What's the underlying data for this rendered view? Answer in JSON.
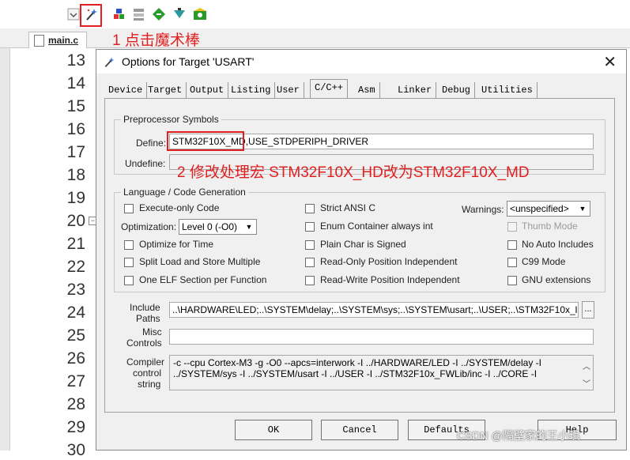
{
  "toolbar": {
    "icons": [
      "dropdown-icon",
      "magic-wand-icon",
      "build-icon",
      "batch-icon",
      "download-icon",
      "debug-icon",
      "manage-icon"
    ]
  },
  "annotations": {
    "step1": "1 点击魔术棒",
    "step2": "2 修改处理宏 STM32F10X_HD改为STM32F10X_MD"
  },
  "editor": {
    "file_tab": "main.c",
    "line_numbers": [
      "13",
      "14",
      "15",
      "16",
      "17",
      "18",
      "19",
      "20",
      "21",
      "22",
      "23",
      "24",
      "25",
      "26",
      "27",
      "28",
      "29",
      "30"
    ]
  },
  "dialog": {
    "title": "Options for Target 'USART'",
    "close": "✕",
    "tabs": [
      "Device",
      "Target",
      "Output",
      "Listing",
      "User",
      "C/C++",
      "Asm",
      "Linker",
      "Debug",
      "Utilities"
    ],
    "active_tab": "C/C++",
    "preprocessor": {
      "group_title": "Preprocessor Symbols",
      "define_label": "Define:",
      "define_value": "STM32F10X_MD,USE_STDPERIPH_DRIVER",
      "undefine_label": "Undefine:",
      "undefine_value": ""
    },
    "codegen": {
      "group_title": "Language / Code Generation",
      "execute_only": "Execute-only Code",
      "optimization_label": "Optimization:",
      "optimization_value": "Level 0 (-O0)",
      "optimize_time": "Optimize for Time",
      "split_load": "Split Load and Store Multiple",
      "one_elf": "One ELF Section per Function",
      "strict_ansi": "Strict ANSI C",
      "enum_container": "Enum Container always int",
      "plain_char": "Plain Char is Signed",
      "ro_pi": "Read-Only Position Independent",
      "rw_pi": "Read-Write Position Independent",
      "warnings_label": "Warnings:",
      "warnings_value": "<unspecified>",
      "thumb_mode": "Thumb Mode",
      "no_auto_includes": "No Auto Includes",
      "c99_mode": "C99 Mode",
      "gnu_ext": "GNU extensions"
    },
    "include_label_1": "Include",
    "include_label_2": "Paths",
    "include_value": "..\\HARDWARE\\LED;..\\SYSTEM\\delay;..\\SYSTEM\\sys;..\\SYSTEM\\usart;..\\USER;..\\STM32F10x_l",
    "include_browse": "...",
    "misc_label_1": "Misc",
    "misc_label_2": "Controls",
    "misc_value": "",
    "compiler_label_1": "Compiler",
    "compiler_label_2": "control",
    "compiler_label_3": "string",
    "compiler_line1": "-c --cpu Cortex-M3 -g -O0 --apcs=interwork -I ../HARDWARE/LED -I ../SYSTEM/delay -I",
    "compiler_line2": "../SYSTEM/sys -I ../SYSTEM/usart -I ../USER -I ../STM32F10x_FWLib/inc -I ../CORE -I",
    "buttons": {
      "ok": "OK",
      "cancel": "Cancel",
      "defaults": "Defaults",
      "help": "Help"
    }
  },
  "watermark": "CSDN @隔壁家的王小琪"
}
